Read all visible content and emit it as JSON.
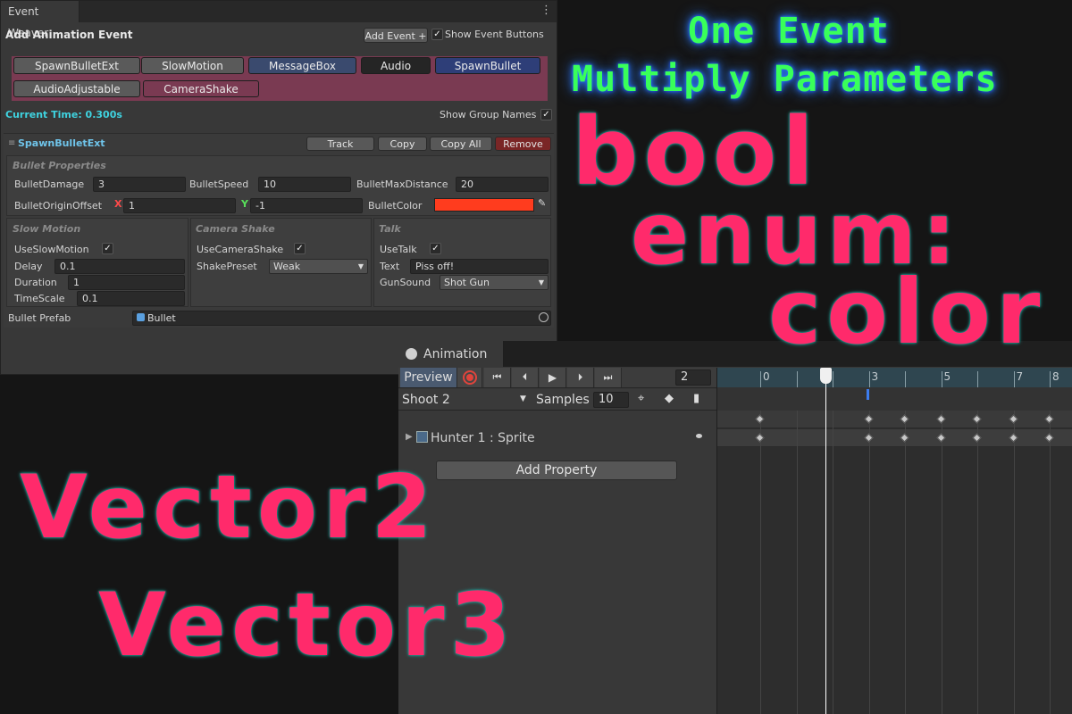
{
  "event_weaver": {
    "tab_title": "Event Weaver",
    "menu_icon": "kebab-icon",
    "section_title": "Add Animation Event",
    "add_event_label": "Add Event +",
    "show_event_buttons_label": "Show Event Buttons",
    "show_event_buttons_checked": "✓",
    "event_buttons": [
      {
        "label": "SpawnBulletExt",
        "color": "#7a3a52"
      },
      {
        "label": "SlowMotion",
        "color": "#5a5a5a"
      },
      {
        "label": "MessageBox",
        "color": "#5a5a5a"
      },
      {
        "label": "Audio",
        "color": "#3a4a6e"
      },
      {
        "label": "SpawnBullet",
        "color": "#252525"
      },
      {
        "label": "AudioAdjustable",
        "color": "#2e3e78"
      },
      {
        "label": "CameraShake",
        "color": "#5a5a5a"
      }
    ],
    "current_time": "Current Time: 0.300s",
    "current_time_color": "#3fd3e0",
    "show_group_names_label": "Show Group Names",
    "show_group_names_checked": "✓",
    "event": {
      "name": "SpawnBulletExt",
      "name_color": "#6fc4ea",
      "track_label": "Track",
      "copy_label": "Copy",
      "copy_all_label": "Copy All",
      "remove_label": "Remove",
      "remove_color": "#7a2626",
      "bullet_group": "Bullet Properties",
      "bullet_damage_label": "BulletDamage",
      "bullet_damage": "3",
      "bullet_speed_label": "BulletSpeed",
      "bullet_speed": "10",
      "bullet_max_distance_label": "BulletMaxDistance",
      "bullet_max_distance": "20",
      "origin_offset_label": "BulletOriginOffset",
      "x_label": "X",
      "x_value": "1",
      "y_label": "Y",
      "y_value": "-1",
      "bullet_color_label": "BulletColor",
      "bullet_color": "#ff3c1e",
      "slow_group": "Slow Motion",
      "use_slow_label": "UseSlowMotion",
      "use_slow_checked": "✓",
      "delay_label": "Delay",
      "delay": "0.1",
      "duration_label": "Duration",
      "duration": "1",
      "timescale_label": "TimeScale",
      "timescale": "0.1",
      "camera_group": "Camera Shake",
      "use_camera_label": "UseCameraShake",
      "use_camera_checked": "✓",
      "shake_preset_label": "ShakePreset",
      "shake_preset": "Weak",
      "talk_group": "Talk",
      "use_talk_label": "UseTalk",
      "use_talk_checked": "✓",
      "text_label": "Text",
      "text_value": "Piss off!",
      "gun_sound_label": "GunSound",
      "gun_sound": "Shot Gun",
      "prefab_label": "Bullet Prefab",
      "prefab_value": "Bullet"
    }
  },
  "animation": {
    "tab_title": "Animation",
    "preview_label": "Preview",
    "frame": "2",
    "clip": "Shoot 2",
    "samples_label": "Samples",
    "samples": "10",
    "property": "Hunter 1 : Sprite",
    "add_property_label": "Add Property",
    "ruler_ticks": [
      "0",
      "1",
      "2",
      "3",
      "4",
      "5",
      "6",
      "7",
      "8"
    ],
    "ruler_labels": [
      "0",
      "3",
      "5",
      "7",
      "8"
    ],
    "playhead": 1.8,
    "event_marker": 2.95,
    "keyframes": [
      0,
      3,
      4,
      5,
      6,
      7,
      8
    ]
  },
  "overlay": {
    "line1": "One Event",
    "line2": "Multiply Parameters",
    "bool": "bool",
    "enum": "enum:",
    "color": "color",
    "vector2": "Vector2",
    "vector3": "Vector3"
  }
}
